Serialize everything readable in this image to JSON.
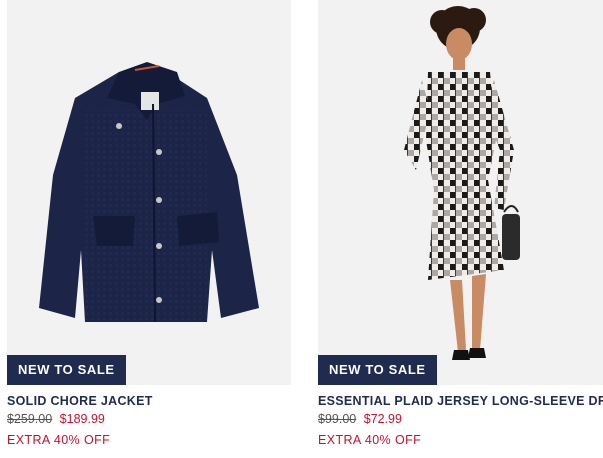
{
  "products": [
    {
      "badge": "NEW TO SALE",
      "name": "SOLID CHORE JACKET",
      "original_price": "$259.00",
      "sale_price": "$189.99",
      "promo": "EXTRA 40% OFF",
      "image": "navy-chore-jacket-photo"
    },
    {
      "badge": "NEW TO SALE",
      "name": "ESSENTIAL PLAID JERSEY LONG-SLEEVE DRESS",
      "original_price": "$99.00",
      "sale_price": "$72.99",
      "promo": "EXTRA 40% OFF",
      "image": "model-plaid-dress-photo"
    }
  ],
  "colors": {
    "badge_bg": "#1f2b4f",
    "name_text": "#1f2b4f",
    "sale_red": "#c8102e",
    "image_bg": "#f2f2f2"
  }
}
